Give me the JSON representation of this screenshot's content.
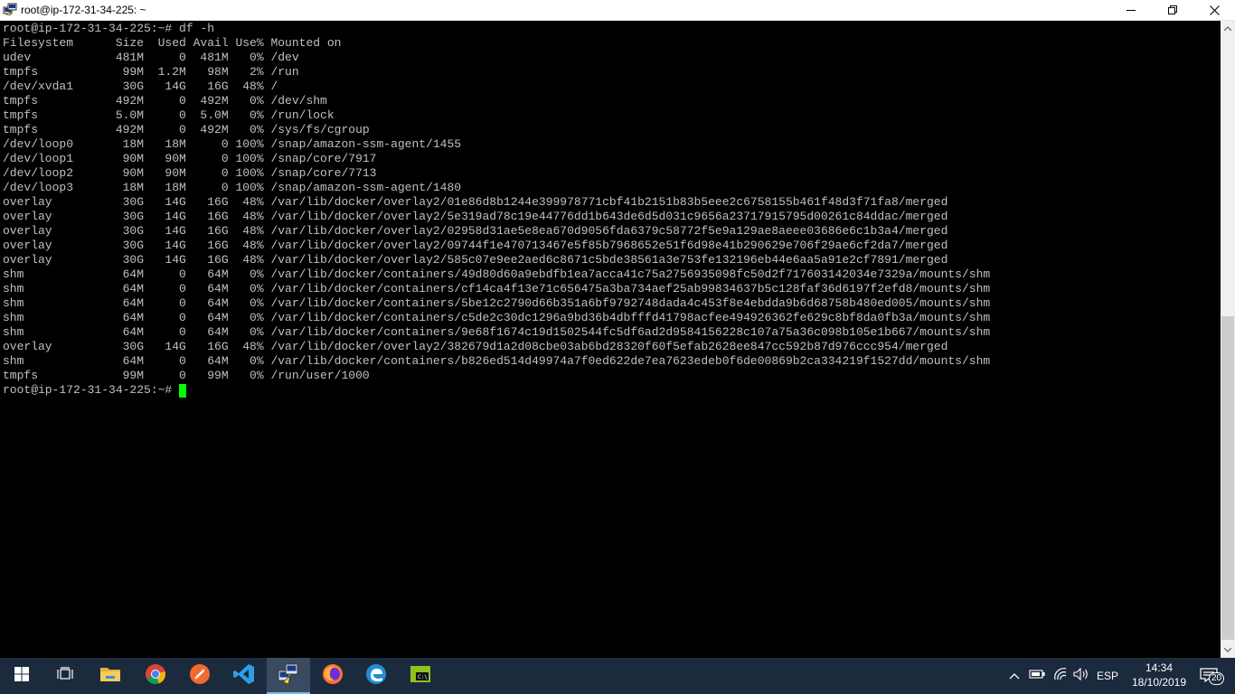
{
  "window": {
    "title": "root@ip-172-31-34-225: ~"
  },
  "terminal": {
    "lines": [
      "root@ip-172-31-34-225:~# df -h",
      "Filesystem      Size  Used Avail Use% Mounted on",
      "udev            481M     0  481M   0% /dev",
      "tmpfs            99M  1.2M   98M   2% /run",
      "/dev/xvda1       30G   14G   16G  48% /",
      "tmpfs           492M     0  492M   0% /dev/shm",
      "tmpfs           5.0M     0  5.0M   0% /run/lock",
      "tmpfs           492M     0  492M   0% /sys/fs/cgroup",
      "/dev/loop0       18M   18M     0 100% /snap/amazon-ssm-agent/1455",
      "/dev/loop1       90M   90M     0 100% /snap/core/7917",
      "/dev/loop2       90M   90M     0 100% /snap/core/7713",
      "/dev/loop3       18M   18M     0 100% /snap/amazon-ssm-agent/1480",
      "overlay          30G   14G   16G  48% /var/lib/docker/overlay2/01e86d8b1244e399978771cbf41b2151b83b5eee2c6758155b461f48d3f71fa8/merged",
      "overlay          30G   14G   16G  48% /var/lib/docker/overlay2/5e319ad78c19e44776dd1b643de6d5d031c9656a23717915795d00261c84ddac/merged",
      "overlay          30G   14G   16G  48% /var/lib/docker/overlay2/02958d31ae5e8ea670d9056fda6379c58772f5e9a129ae8aeee03686e6c1b3a4/merged",
      "overlay          30G   14G   16G  48% /var/lib/docker/overlay2/09744f1e470713467e5f85b7968652e51f6d98e41b290629e706f29ae6cf2da7/merged",
      "overlay          30G   14G   16G  48% /var/lib/docker/overlay2/585c07e9ee2aed6c8671c5bde38561a3e753fe132196eb44e6aa5a91e2cf7891/merged",
      "shm              64M     0   64M   0% /var/lib/docker/containers/49d80d60a9ebdfb1ea7acca41c75a2756935098fc50d2f717603142034e7329a/mounts/shm",
      "shm              64M     0   64M   0% /var/lib/docker/containers/cf14ca4f13e71c656475a3ba734aef25ab99834637b5c128faf36d6197f2efd8/mounts/shm",
      "shm              64M     0   64M   0% /var/lib/docker/containers/5be12c2790d66b351a6bf9792748dada4c453f8e4ebdda9b6d68758b480ed005/mounts/shm",
      "shm              64M     0   64M   0% /var/lib/docker/containers/c5de2c30dc1296a9bd36b4dbfffd41798acfee494926362fe629c8bf8da0fb3a/mounts/shm",
      "shm              64M     0   64M   0% /var/lib/docker/containers/9e68f1674c19d1502544fc5df6ad2d9584156228c107a75a36c098b105e1b667/mounts/shm",
      "overlay          30G   14G   16G  48% /var/lib/docker/overlay2/382679d1a2d08cbe03ab6bd28320f60f5efab2628ee847cc592b87d976ccc954/merged",
      "shm              64M     0   64M   0% /var/lib/docker/containers/b826ed514d49974a7f0ed622de7ea7623edeb0f6de00869b2ca334219f1527dd/mounts/shm",
      "tmpfs            99M     0   99M   0% /run/user/1000"
    ],
    "prompt": "root@ip-172-31-34-225:~# ",
    "text_color": "#c0c0c0",
    "cursor_color": "#00ff00"
  },
  "taskbar": {
    "items": [
      {
        "icon": "windows-start-icon",
        "active": false
      },
      {
        "icon": "task-view-icon",
        "active": false
      },
      {
        "icon": "file-explorer-icon",
        "active": false
      },
      {
        "icon": "chrome-icon",
        "active": false
      },
      {
        "icon": "sublime-text-icon",
        "active": false
      },
      {
        "icon": "vscode-icon",
        "active": false
      },
      {
        "icon": "putty-icon",
        "active": true
      },
      {
        "icon": "firefox-icon",
        "active": false
      },
      {
        "icon": "edge-icon",
        "active": false
      },
      {
        "icon": "terminal-icon",
        "active": false
      }
    ],
    "language": "ESP",
    "time": "14:34",
    "date": "18/10/2019",
    "notification_count": "20"
  }
}
